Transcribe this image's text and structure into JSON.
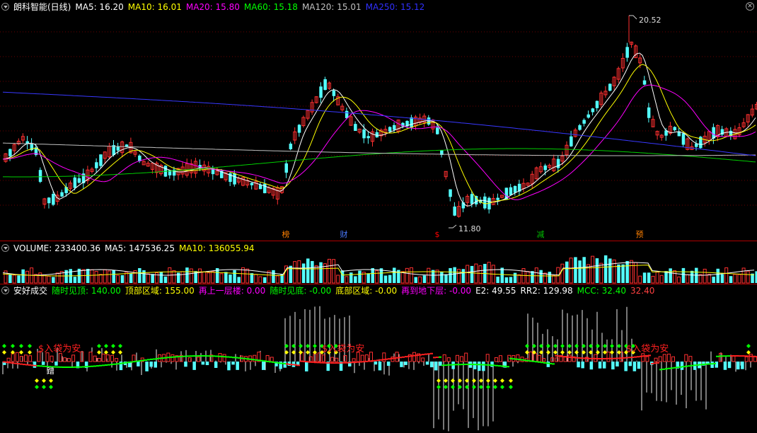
{
  "price": {
    "title": "朗科智能(日线)",
    "ma": [
      {
        "label": "MA5: 16.20",
        "color": "#ffffff"
      },
      {
        "label": "MA10: 16.01",
        "color": "#ffff00"
      },
      {
        "label": "MA20: 15.80",
        "color": "#ff00ff"
      },
      {
        "label": "MA60: 15.18",
        "color": "#00ff00"
      },
      {
        "label": "MA120: 15.01",
        "color": "#c0c0c0"
      },
      {
        "label": "MA250: 15.12",
        "color": "#3030ff"
      }
    ],
    "high_label": "20.52",
    "low_label": "11.80",
    "events": [
      {
        "text": "榜",
        "color": "#ff8000"
      },
      {
        "text": "财",
        "color": "#4a7aff"
      },
      {
        "text": "$",
        "color": "#ff0000"
      },
      {
        "text": "减",
        "color": "#00c000"
      },
      {
        "text": "预",
        "color": "#ff8000"
      }
    ]
  },
  "volume": {
    "title": "VOLUME: 233400.36",
    "ma5": "MA5: 147536.25",
    "ma10": "MA10: 136055.94"
  },
  "indicator": {
    "title": "安好成交",
    "items": [
      {
        "label": "随时见顶: 140.00",
        "color": "#00ff00"
      },
      {
        "label": "顶部区域: 155.00",
        "color": "#ffff00"
      },
      {
        "label": "再上一层楼: 0.00",
        "color": "#ff00ff"
      },
      {
        "label": "随时见底: -0.00",
        "color": "#00ff00"
      },
      {
        "label": "底部区域: -0.00",
        "color": "#ffff00"
      },
      {
        "label": "再到地下层: -0.00",
        "color": "#ff00ff"
      },
      {
        "label": "E2: 49.55",
        "color": "#ffffff"
      },
      {
        "label": "RR2: 129.98",
        "color": "#ffffff"
      },
      {
        "label": "MCC: 32.40",
        "color": "#00ff00"
      },
      {
        "label": "32.40",
        "color": "#ff4040"
      }
    ],
    "signal_text": "$入袋为安",
    "signal_color": "#ff2020",
    "small_text": "蹭"
  },
  "chart_data": {
    "type": "candlestick",
    "y_range_price": [
      11.8,
      20.52
    ],
    "moving_averages": [
      "MA5",
      "MA10",
      "MA20",
      "MA60",
      "MA120",
      "MA250"
    ]
  }
}
